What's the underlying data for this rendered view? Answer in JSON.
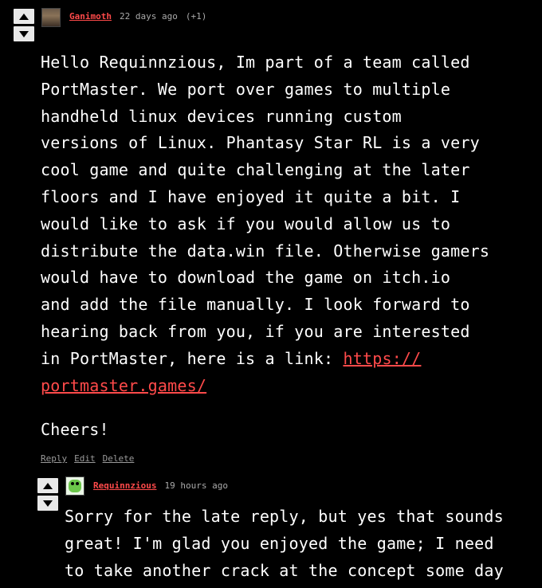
{
  "comment1": {
    "author": "Ganimoth",
    "time": "22 days ago",
    "score": "(+1)",
    "body_main": "Hello Requinnzious, Im part of a team called\nPortMaster. We port over games to multiple\nhandheld linux devices running custom\nversions of Linux. Phantasy Star RL is a very\ncool game and quite challenging at the later\nfloors and I have enjoyed it quite a bit. I\nwould like to ask if you would allow us to\ndistribute the data.win file. Otherwise gamers\nwould have to download the game on itch.io\nand add the file manually. I look forward to\nhearing back from you, if you are interested\nin PortMaster, here is a link: ",
    "link_part1": "https://",
    "link_part2": "portmaster.games/",
    "cheers": "Cheers!",
    "actions": {
      "reply": "Reply",
      "edit": "Edit",
      "delete": "Delete"
    }
  },
  "comment2": {
    "author": "Requinnzious",
    "time": "19 hours ago",
    "body": "Sorry for the late reply, but yes that sounds\ngreat! I'm glad you enjoyed the game; I need\nto take another crack at the concept some day"
  },
  "icons": {
    "upvote": "upvote-arrow-icon",
    "downvote": "downvote-arrow-icon"
  },
  "colors": {
    "background": "#000000",
    "text": "#ffffff",
    "accent": "#ff4a4a",
    "muted": "#9a9a9a"
  }
}
